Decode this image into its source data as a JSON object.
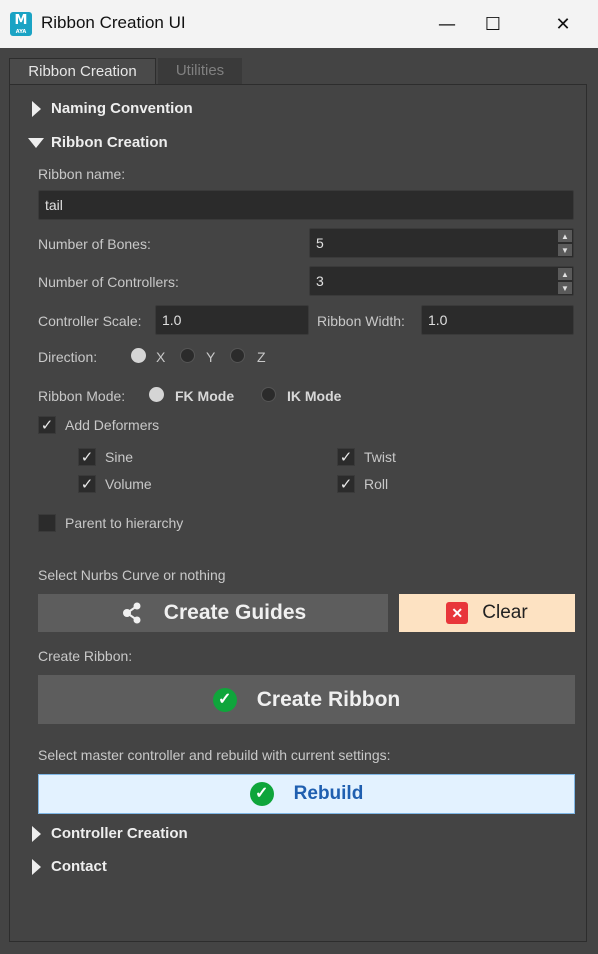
{
  "window": {
    "title": "Ribbon Creation UI",
    "icon_letter": "M",
    "icon_sub": "AYA",
    "controls": {
      "minimize": "—",
      "maximize": "☐",
      "close": "✕"
    }
  },
  "tabs": [
    {
      "label": "Ribbon Creation",
      "active": true
    },
    {
      "label": "Utilities",
      "active": false
    }
  ],
  "sections": {
    "naming": "Naming Convention",
    "ribbon": "Ribbon Creation",
    "controller": "Controller Creation",
    "contact": "Contact"
  },
  "ribbon": {
    "name_label": "Ribbon name:",
    "name_value": "tail",
    "bones_label": "Number of Bones:",
    "bones_value": "5",
    "controllers_label": "Number of Controllers:",
    "controllers_value": "3",
    "scale_label": "Controller Scale:",
    "scale_value": "1.0",
    "width_label": "Ribbon Width:",
    "width_value": "1.0",
    "direction_label": "Direction:",
    "direction_options": [
      "X",
      "Y",
      "Z"
    ],
    "direction_selected": "X",
    "mode_label": "Ribbon Mode:",
    "mode_options": [
      "FK Mode",
      "IK Mode"
    ],
    "mode_selected": "FK Mode",
    "add_deformers_label": "Add Deformers",
    "deformers": {
      "sine": "Sine",
      "twist": "Twist",
      "volume": "Volume",
      "roll": "Roll"
    },
    "parent_label": "Parent to hierarchy",
    "select_curve_text": "Select Nurbs Curve or nothing",
    "create_guides_label": "Create Guides",
    "clear_label": "Clear",
    "create_ribbon_text": "Create Ribbon:",
    "create_ribbon_label": "Create Ribbon",
    "rebuild_text": "Select master controller and rebuild with current settings:",
    "rebuild_label": "Rebuild"
  },
  "colors": {
    "background": "#444444",
    "field": "#2b2b2b",
    "button_dark": "#5d5d5d",
    "clear_bg": "#fde2c2",
    "rebuild_bg": "#e3f2ff",
    "rebuild_text": "#1f5fb0",
    "ok_green": "#0fa53b",
    "clear_red": "#e8363a"
  },
  "icons": {
    "guides": "nodes-icon",
    "clear": "x-square-icon",
    "create_ribbon": "check-circle-icon",
    "rebuild": "check-circle-icon"
  }
}
